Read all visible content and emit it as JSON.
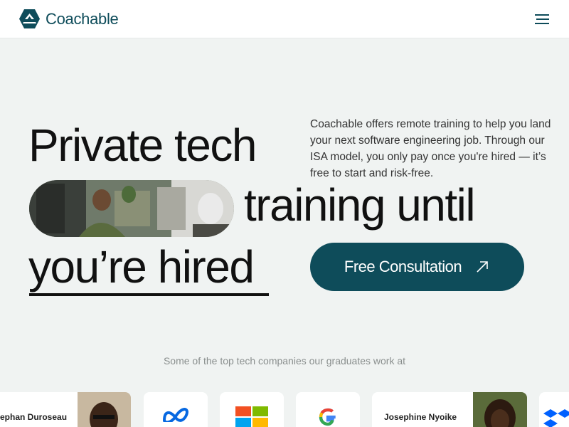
{
  "header": {
    "brand_name": "Coachable",
    "brand_color": "#0e4c5a"
  },
  "hero": {
    "headline_line1": "Private tech",
    "headline_line2": "training until",
    "headline_line3": "you’re hired",
    "intro": "Coachable offers remote training to help you land your next software engineering job. Through our ISA model, you only pay once you're hired — it’s free to start and risk-free.",
    "cta_label": "Free Consultation",
    "cta_icon": "arrow-up-right-icon"
  },
  "companies": {
    "caption": "Some of the top tech companies our graduates work at",
    "cards": [
      {
        "kind": "person",
        "name": "ephan Duroseau"
      },
      {
        "kind": "logo",
        "icon": "meta-logo-icon"
      },
      {
        "kind": "logo",
        "icon": "microsoft-logo-icon"
      },
      {
        "kind": "logo",
        "icon": "google-logo-icon"
      },
      {
        "kind": "person",
        "name": "Josephine Nyoike"
      },
      {
        "kind": "logo",
        "icon": "dropbox-logo-icon"
      }
    ]
  }
}
